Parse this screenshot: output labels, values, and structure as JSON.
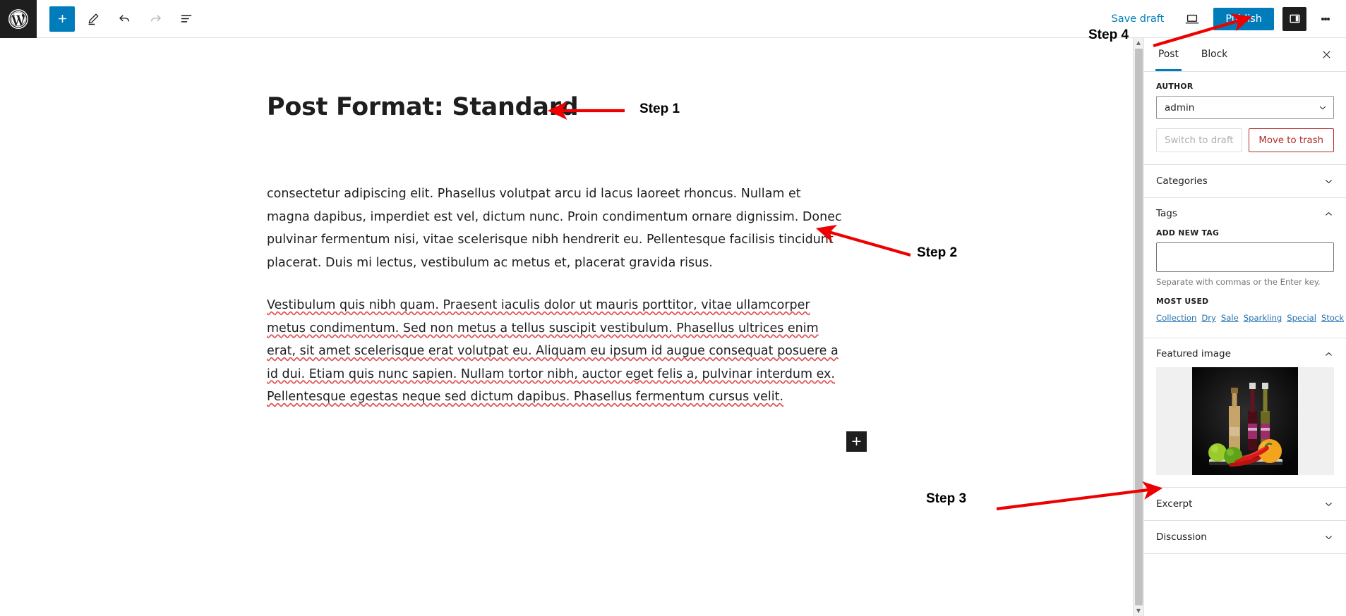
{
  "toolbar": {
    "logo_icon": "wordpress-logo-icon",
    "add_block_icon": "plus-icon",
    "add_block_label": "+",
    "tools_icon": "pencil-icon",
    "undo_icon": "undo-arrow-icon",
    "redo_icon": "redo-arrow-icon",
    "list_view_icon": "list-view-icon",
    "save_draft_label": "Save draft",
    "preview_icon": "laptop-preview-icon",
    "publish_label": "Publish",
    "settings_icon": "sidebar-toggle-icon",
    "options_icon": "vertical-ellipsis-icon",
    "accent_color": "#007cba"
  },
  "editor": {
    "title": "Post Format: Standard",
    "paragraph_1": "consectetur adipiscing elit. Phasellus volutpat arcu id lacus laoreet rhoncus. Nullam et magna dapibus, imperdiet est vel, dictum nunc. Proin condimentum ornare dignissim. Donec pulvinar fermentum nisi, vitae scelerisque nibh hendrerit eu. Pellentesque facilisis tincidunt placerat. Duis mi lectus, vestibulum ac metus et, placerat gravida risus.",
    "paragraph_2": "Vestibulum quis nibh quam. Praesent iaculis dolor ut mauris porttitor, vitae ullamcorper metus condimentum. Sed non metus a tellus suscipit vestibulum. Phasellus ultrices enim erat, sit amet scelerisque erat volutpat eu. Aliquam eu ipsum id augue consequat posuere a id dui. Etiam quis nunc sapien. Nullam tortor nibh, auctor eget felis a, pulvinar interdum ex. Pellentesque egestas neque sed dictum dapibus. Phasellus fermentum cursus velit.",
    "inserter_label": "+",
    "inserter_icon": "plus-icon"
  },
  "sidebar": {
    "tabs": [
      {
        "label": "Post",
        "active": true
      },
      {
        "label": "Block",
        "active": false
      }
    ],
    "close_icon": "close-icon",
    "close_label": "×",
    "author": {
      "label": "AUTHOR",
      "value": "admin",
      "chevron_icon": "chevron-down-icon"
    },
    "switch_to_draft_label": "Switch to draft",
    "move_to_trash_label": "Move to trash",
    "trash_color": "#b32d2e",
    "categories": {
      "label": "Categories",
      "chevron_icon": "chevron-down-icon",
      "expanded": false
    },
    "tags": {
      "label": "Tags",
      "chevron_icon": "chevron-up-icon",
      "expanded": true,
      "add_new_label": "ADD NEW TAG",
      "input_value": "",
      "hint": "Separate with commas or the Enter key.",
      "most_used_label": "MOST USED",
      "most_used": [
        "Collection",
        "Dry",
        "Sale",
        "Sparkling",
        "Special",
        "Stock"
      ]
    },
    "featured_image": {
      "label": "Featured image",
      "chevron_icon": "chevron-up-icon",
      "expanded": true,
      "alt": "Bottles of oil and vinegar with limes, chili peppers and an orange on a black background"
    },
    "excerpt": {
      "label": "Excerpt",
      "chevron_icon": "chevron-down-icon"
    },
    "discussion": {
      "label": "Discussion",
      "chevron_icon": "chevron-down-icon"
    },
    "scrollbar": {
      "up_arrow_icon": "triangle-up-icon",
      "down_arrow_icon": "triangle-down-icon"
    }
  },
  "annotations": {
    "color": "#ee0000",
    "steps": [
      {
        "label": "Step 1"
      },
      {
        "label": "Step 2"
      },
      {
        "label": "Step 3"
      },
      {
        "label": "Step 4"
      }
    ]
  }
}
